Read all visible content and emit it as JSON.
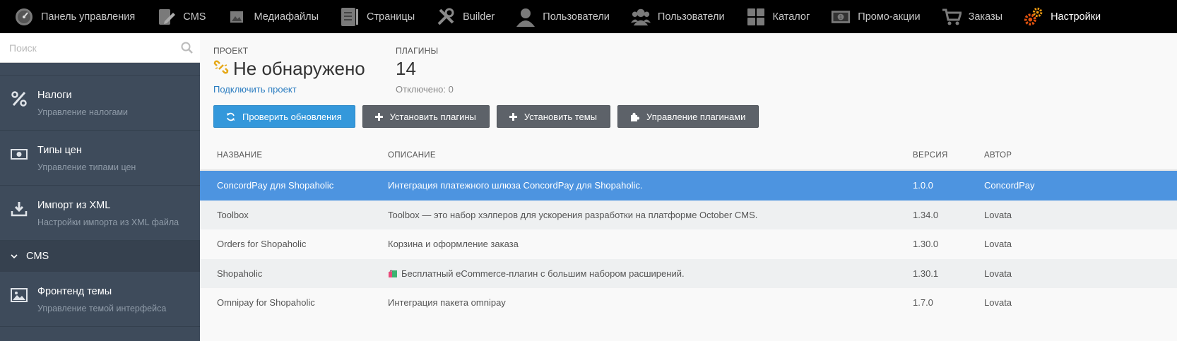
{
  "topnav": {
    "items": [
      {
        "label": "Панель управления",
        "icon": "dashboard-gauge-icon"
      },
      {
        "label": "CMS",
        "icon": "cms-pencil-icon"
      },
      {
        "label": "Медиафайлы",
        "icon": "media-image-icon"
      },
      {
        "label": "Страницы",
        "icon": "pages-document-icon"
      },
      {
        "label": "Builder",
        "icon": "builder-wrench-icon"
      },
      {
        "label": "Пользователи",
        "icon": "user-icon"
      },
      {
        "label": "Пользователи",
        "icon": "users-group-icon"
      },
      {
        "label": "Каталог",
        "icon": "catalog-grid-icon"
      },
      {
        "label": "Промо-акции",
        "icon": "promo-banknote-icon"
      },
      {
        "label": "Заказы",
        "icon": "orders-cart-icon"
      },
      {
        "label": "Настройки",
        "icon": "settings-gears-icon",
        "active": true
      }
    ]
  },
  "sidebar": {
    "search_placeholder": "Поиск",
    "items": [
      {
        "title": "Налоги",
        "desc": "Управление налогами",
        "icon": "percent-icon"
      },
      {
        "title": "Типы цен",
        "desc": "Управление типами цен",
        "icon": "price-banknote-icon"
      },
      {
        "title": "Импорт из XML",
        "desc": "Настройки импорта из XML файла",
        "icon": "download-icon"
      }
    ],
    "group": {
      "label": "CMS"
    },
    "group_items": [
      {
        "title": "Фронтенд темы",
        "desc": "Управление темой интерфейса",
        "icon": "picture-icon"
      }
    ]
  },
  "project": {
    "label": "ПРОЕКТ",
    "value": "Не обнаружено",
    "link": "Подключить проект"
  },
  "plugins": {
    "label": "ПЛАГИНЫ",
    "value": "14",
    "disabled": "Отключено: 0"
  },
  "toolbar": {
    "check_updates": "Проверить обновления",
    "install_plugins": "Установить плагины",
    "install_themes": "Установить темы",
    "manage_plugins": "Управление плагинами"
  },
  "table": {
    "columns": [
      "НАЗВАНИЕ",
      "ОПИСАНИЕ",
      "ВЕРСИЯ",
      "АВТОР"
    ],
    "rows": [
      {
        "name": "ConcordPay для Shopaholic",
        "description": "Интеграция платежного шлюза ConcordPay для Shopaholic.",
        "version": "1.0.0",
        "author": "ConcordPay"
      },
      {
        "name": "Toolbox",
        "description": "Toolbox — это набор хэлперов для ускорения разработки на платформе October CMS.",
        "version": "1.34.0",
        "author": "Lovata"
      },
      {
        "name": "Orders for Shopaholic",
        "description": "Корзина и оформление заказа",
        "version": "1.30.0",
        "author": "Lovata"
      },
      {
        "name": "Shopaholic",
        "description": "Бесплатный eCommerce-плагин с большим набором расширений.",
        "version": "1.30.1",
        "author": "Lovata"
      },
      {
        "name": "Omnipay for Shopaholic",
        "description": "Интеграция пакета omnipay",
        "version": "1.7.0",
        "author": "Lovata"
      }
    ]
  },
  "colors": {
    "topbar": "#000000",
    "sidebar": "#3e4b5b",
    "primary_button": "#3498db",
    "secondary_button": "#5d6269",
    "selected_row": "#4d94e0",
    "link": "#2a7cc0",
    "active_icon": "#e0520f"
  }
}
